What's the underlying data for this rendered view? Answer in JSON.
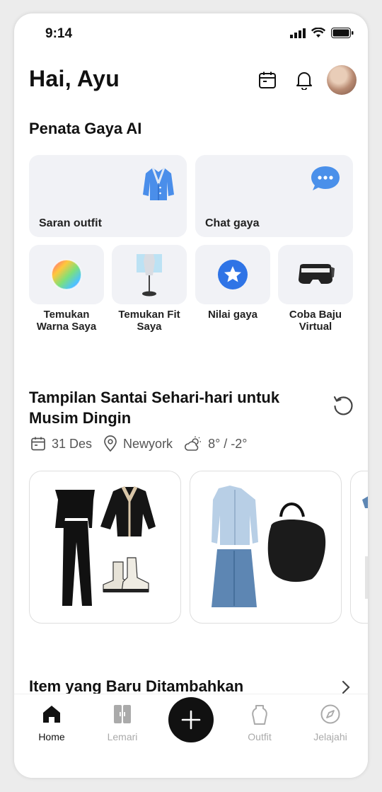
{
  "status_bar": {
    "time": "9:14"
  },
  "header": {
    "greeting": "Hai, Ayu"
  },
  "stylist": {
    "title": "Penata Gaya AI",
    "large_cards": [
      {
        "label": "Saran outfit",
        "icon": "cardigan-icon"
      },
      {
        "label": "Chat gaya",
        "icon": "chat-bubble-icon"
      }
    ],
    "small_cards": [
      {
        "label": "Temukan Warna Saya",
        "icon": "color-wheel-icon"
      },
      {
        "label": "Temukan Fit Saya",
        "icon": "mannequin-icon"
      },
      {
        "label": "Nilai gaya",
        "icon": "star-badge-icon"
      },
      {
        "label": "Coba Baju Virtual",
        "icon": "vr-headset-icon"
      }
    ]
  },
  "look": {
    "title": "Tampilan Santai Sehari-hari untuk Musim Dingin",
    "date": "31 Des",
    "location": "Newyork",
    "weather": "8° / -2°"
  },
  "recent": {
    "title": "Item yang Baru Ditambahkan"
  },
  "nav": {
    "items": [
      {
        "label": "Home",
        "icon": "home-icon",
        "active": true
      },
      {
        "label": "Lemari",
        "icon": "wardrobe-icon",
        "active": false
      },
      {
        "label": "Outfit",
        "icon": "outfit-icon",
        "active": false
      },
      {
        "label": "Jelajahi",
        "icon": "compass-icon",
        "active": false
      }
    ],
    "fab_icon": "plus-icon"
  },
  "colors": {
    "accent": "#3b82f6",
    "card_bg": "#f1f2f6",
    "nav_inactive": "#aaaaaa"
  }
}
